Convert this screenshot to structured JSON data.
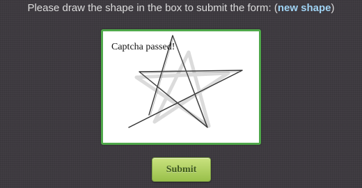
{
  "instruction": {
    "text": "Please draw the shape in the box to submit the form:",
    "open_paren": "(",
    "link_label": "new shape",
    "close_paren": ")"
  },
  "captcha": {
    "status": "Captcha passed!",
    "target_shape": "star-icon"
  },
  "form": {
    "submit_label": "Submit"
  },
  "colors": {
    "page_background": "#3e3a40",
    "box_border": "#4fa84a",
    "link": "#9fd2f2",
    "button_top": "#c9e27f",
    "button_bottom": "#99c04a"
  }
}
